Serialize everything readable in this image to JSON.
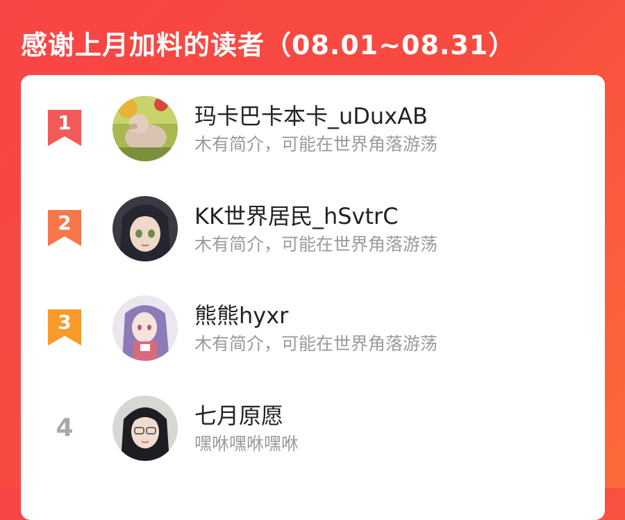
{
  "header": {
    "title": "感谢上月加料的读者（08.01~08.31）"
  },
  "colors": {
    "background": "#f74545",
    "rank1": "#f25a5a",
    "rank2": "#f7774a",
    "rank3": "#f99a2b",
    "rank_plain": "#a8a8a8"
  },
  "readers": [
    {
      "rank": "1",
      "name": "玛卡巴卡本卡_uDuxAB",
      "bio": "木有简介，可能在世界角落游荡",
      "avatar_icon": "pig-avatar-icon"
    },
    {
      "rank": "2",
      "name": "KK世界居民_hSvtrC",
      "bio": "木有简介，可能在世界角落游荡",
      "avatar_icon": "anime-girl-avatar-icon"
    },
    {
      "rank": "3",
      "name": "熊熊hyxr",
      "bio": "木有简介，可能在世界角落游荡",
      "avatar_icon": "anime-girl-avatar-icon"
    },
    {
      "rank": "4",
      "name": "七月原愿",
      "bio": "嘿咻嘿咻嘿咻",
      "avatar_icon": "person-avatar-icon"
    }
  ]
}
